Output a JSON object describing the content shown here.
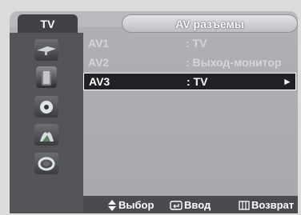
{
  "menu": {
    "tab_label": "TV",
    "title": "AV разъемы",
    "sidebar_icons": [
      "antenna-icon",
      "speaker-icon",
      "disc-icon",
      "plant-icon",
      "coil-icon"
    ],
    "rows": [
      {
        "label": "AV1",
        "value": ": TV",
        "selected": false
      },
      {
        "label": "AV2",
        "value": ": Выход-монитор",
        "selected": false
      },
      {
        "label": "AV3",
        "value": ": TV",
        "selected": true,
        "arrow": "►"
      }
    ]
  },
  "footer": {
    "select": "Выбор",
    "enter": "Ввод",
    "back": "Возврат"
  },
  "colors": {
    "sidebar": "#545559",
    "selected_row": "#202124",
    "panel": "#b9babd"
  }
}
